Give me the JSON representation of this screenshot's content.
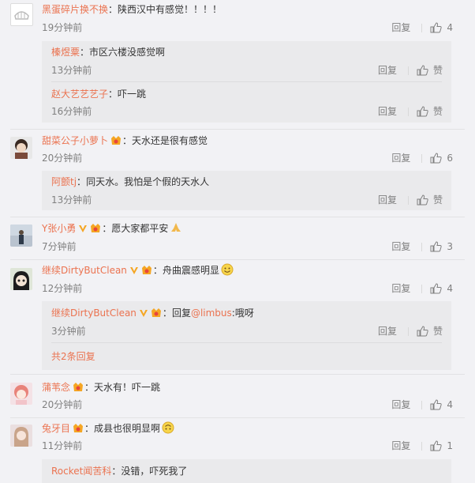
{
  "labels": {
    "reply": "回复",
    "like": "赞",
    "colon": "："
  },
  "c1": {
    "user": "黑蛋碎片换不换",
    "text": "陕西汉中有感觉！！！！",
    "time": "19分钟前",
    "likes": "4"
  },
  "c1r1": {
    "user": "榛煜粟",
    "text": "市区六楼没感觉啊",
    "time": "13分钟前"
  },
  "c1r2": {
    "user": "赵大艺艺艺子",
    "text": "吓一跳",
    "time": "16分钟前"
  },
  "c2": {
    "user": "甜菜公子小萝卜",
    "text": "天水还是很有感觉",
    "time": "20分钟前",
    "likes": "6"
  },
  "c2r1": {
    "user": "阿颤tj",
    "text": "同天水。我怕是个假的天水人",
    "time": "13分钟前"
  },
  "c3": {
    "user": "Y张小勇",
    "text": "愿大家都平安",
    "time": "7分钟前",
    "likes": "3"
  },
  "c4": {
    "user": "继续DirtyButClean",
    "text": "舟曲震感明显",
    "time": "12分钟前",
    "likes": "4"
  },
  "c4r1": {
    "user": "继续DirtyButClean",
    "reply_prefix": "回复",
    "mention": "@limbus",
    "text": ":哦呀",
    "time": "3分钟前"
  },
  "c4more": {
    "text": "共2条回复"
  },
  "c5": {
    "user": "蒲苇念",
    "text": "天水有！吓一跳",
    "time": "20分钟前",
    "likes": "4"
  },
  "c6": {
    "user": "兔牙目",
    "text": "成县也很明显啊",
    "time": "11分钟前",
    "likes": "1"
  },
  "c6r1": {
    "user": "Rocket闻苦科",
    "text": "没错，吓死我了"
  },
  "colors": {
    "username": "#eb7350",
    "text": "#333333",
    "meta": "#808080",
    "background": "#f2f2f5",
    "subbox": "#eaeaec"
  }
}
